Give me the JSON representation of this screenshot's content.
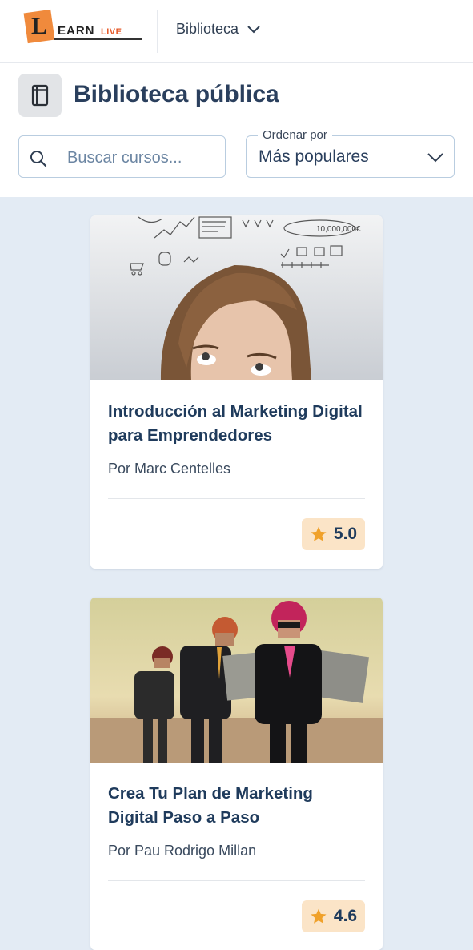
{
  "topbar": {
    "logo": {
      "text_l": "L",
      "text_earn": "EARN",
      "text_live": "LIVE"
    },
    "nav_dropdown": "Biblioteca"
  },
  "header": {
    "title": "Biblioteca pública",
    "search_placeholder": "Buscar cursos...",
    "sort_label": "Ordenar por",
    "sort_value": "Más populares"
  },
  "courses": [
    {
      "title": "Introducción al Marketing Digital para Emprendedores",
      "author": "Por Marc Centelles",
      "rating": "5.0"
    },
    {
      "title": "Crea Tu Plan de Marketing Digital Paso a Paso",
      "author": "Por Pau Rodrigo Millan",
      "rating": "4.6"
    }
  ],
  "colors": {
    "accent": "#1f3b5c",
    "rating_bg": "#fbe4c7",
    "star": "#f0a12a",
    "page_bg": "#e3ebf4"
  }
}
